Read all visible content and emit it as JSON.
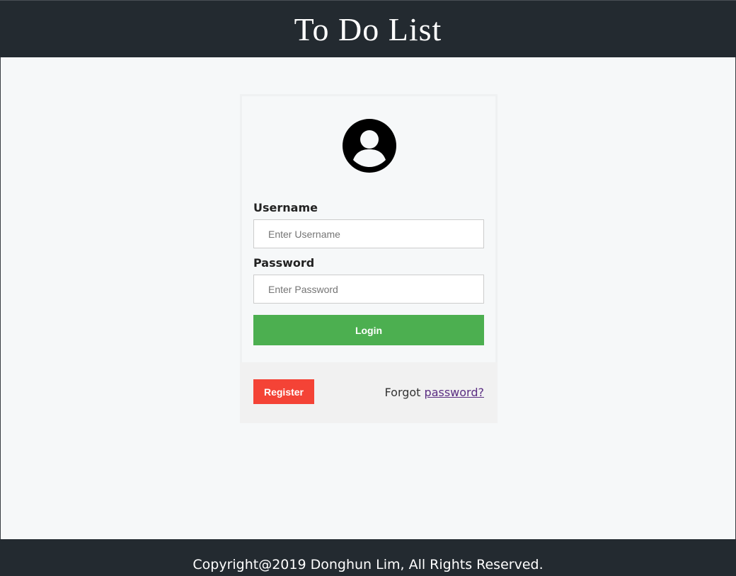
{
  "header": {
    "title": "To Do List"
  },
  "login": {
    "avatar_icon": "user-circle-icon",
    "username_label": "Username",
    "username_placeholder": "Enter Username",
    "username_value": "",
    "password_label": "Password",
    "password_placeholder": "Enter Password",
    "password_value": "",
    "login_label": "Login",
    "register_label": "Register",
    "forgot_text": "Forgot",
    "forgot_link": "password?"
  },
  "footer": {
    "text": "Copyright@2019 Donghun Lim, All Rights Reserved."
  },
  "colors": {
    "header_bg": "#232a30",
    "login_button": "#4caf50",
    "register_button": "#f44336",
    "link": "#5a2d82"
  }
}
